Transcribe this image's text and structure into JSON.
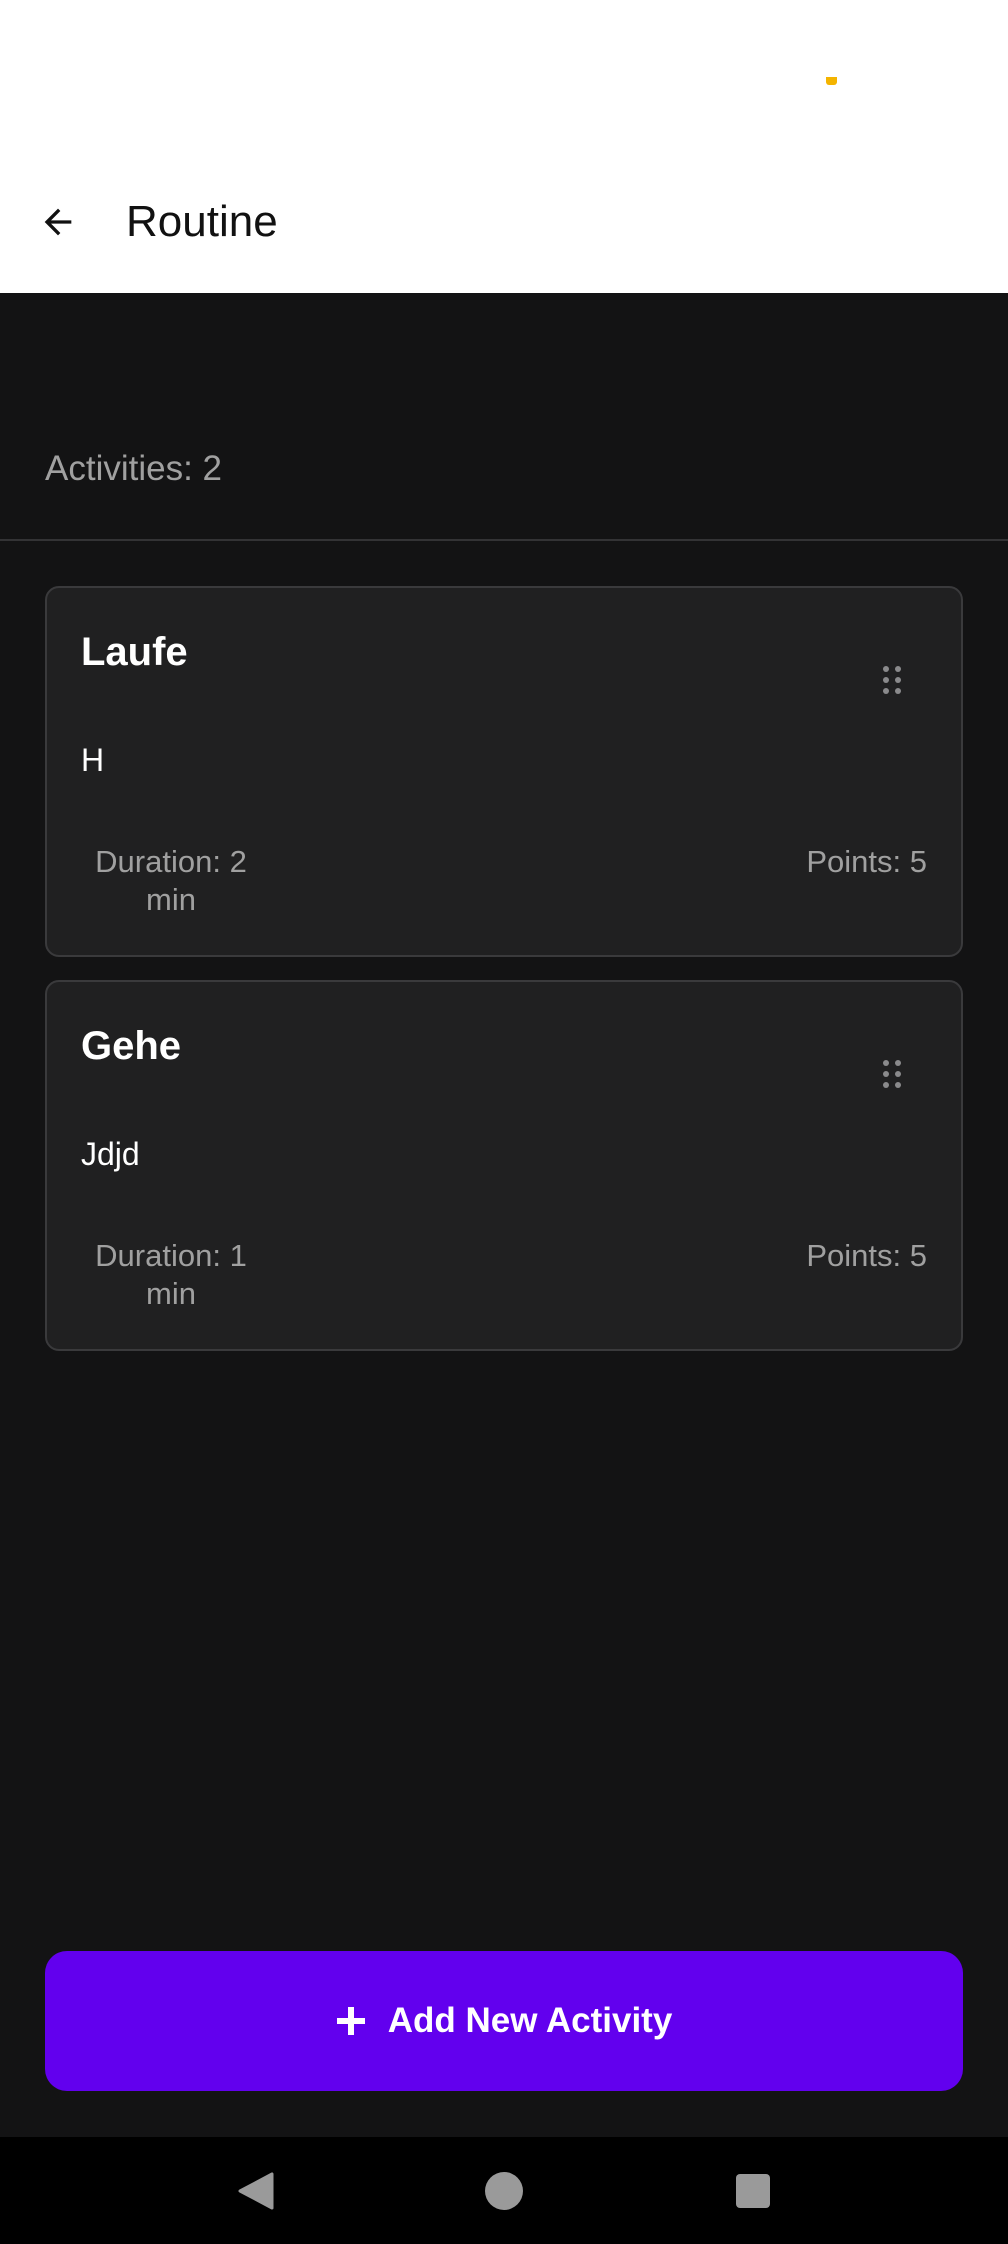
{
  "colors": {
    "accent": "#6200ee",
    "status_indicator": "#f4b400",
    "muted_text": "#a0a0a0",
    "card_background": "#202021",
    "page_background": "#131314"
  },
  "app_bar": {
    "back_icon": "arrow-back-icon",
    "title": "Routine"
  },
  "summary": {
    "activities_count": "Activities: 2"
  },
  "activities": [
    {
      "title": "Laufe",
      "description": "H",
      "duration_label": "Duration: 2",
      "duration_unit": "min",
      "points": "Points: 5",
      "handle_icon": "drag-handle-icon"
    },
    {
      "title": "Gehe",
      "description": "Jdjd",
      "duration_label": "Duration: 1",
      "duration_unit": "min",
      "points": "Points: 5",
      "handle_icon": "drag-handle-icon"
    }
  ],
  "add_button": {
    "icon": "plus-icon",
    "label": "Add New Activity"
  },
  "system_nav": {
    "back_icon": "nav-back-icon",
    "home_icon": "nav-home-icon",
    "recents_icon": "nav-recents-icon"
  }
}
